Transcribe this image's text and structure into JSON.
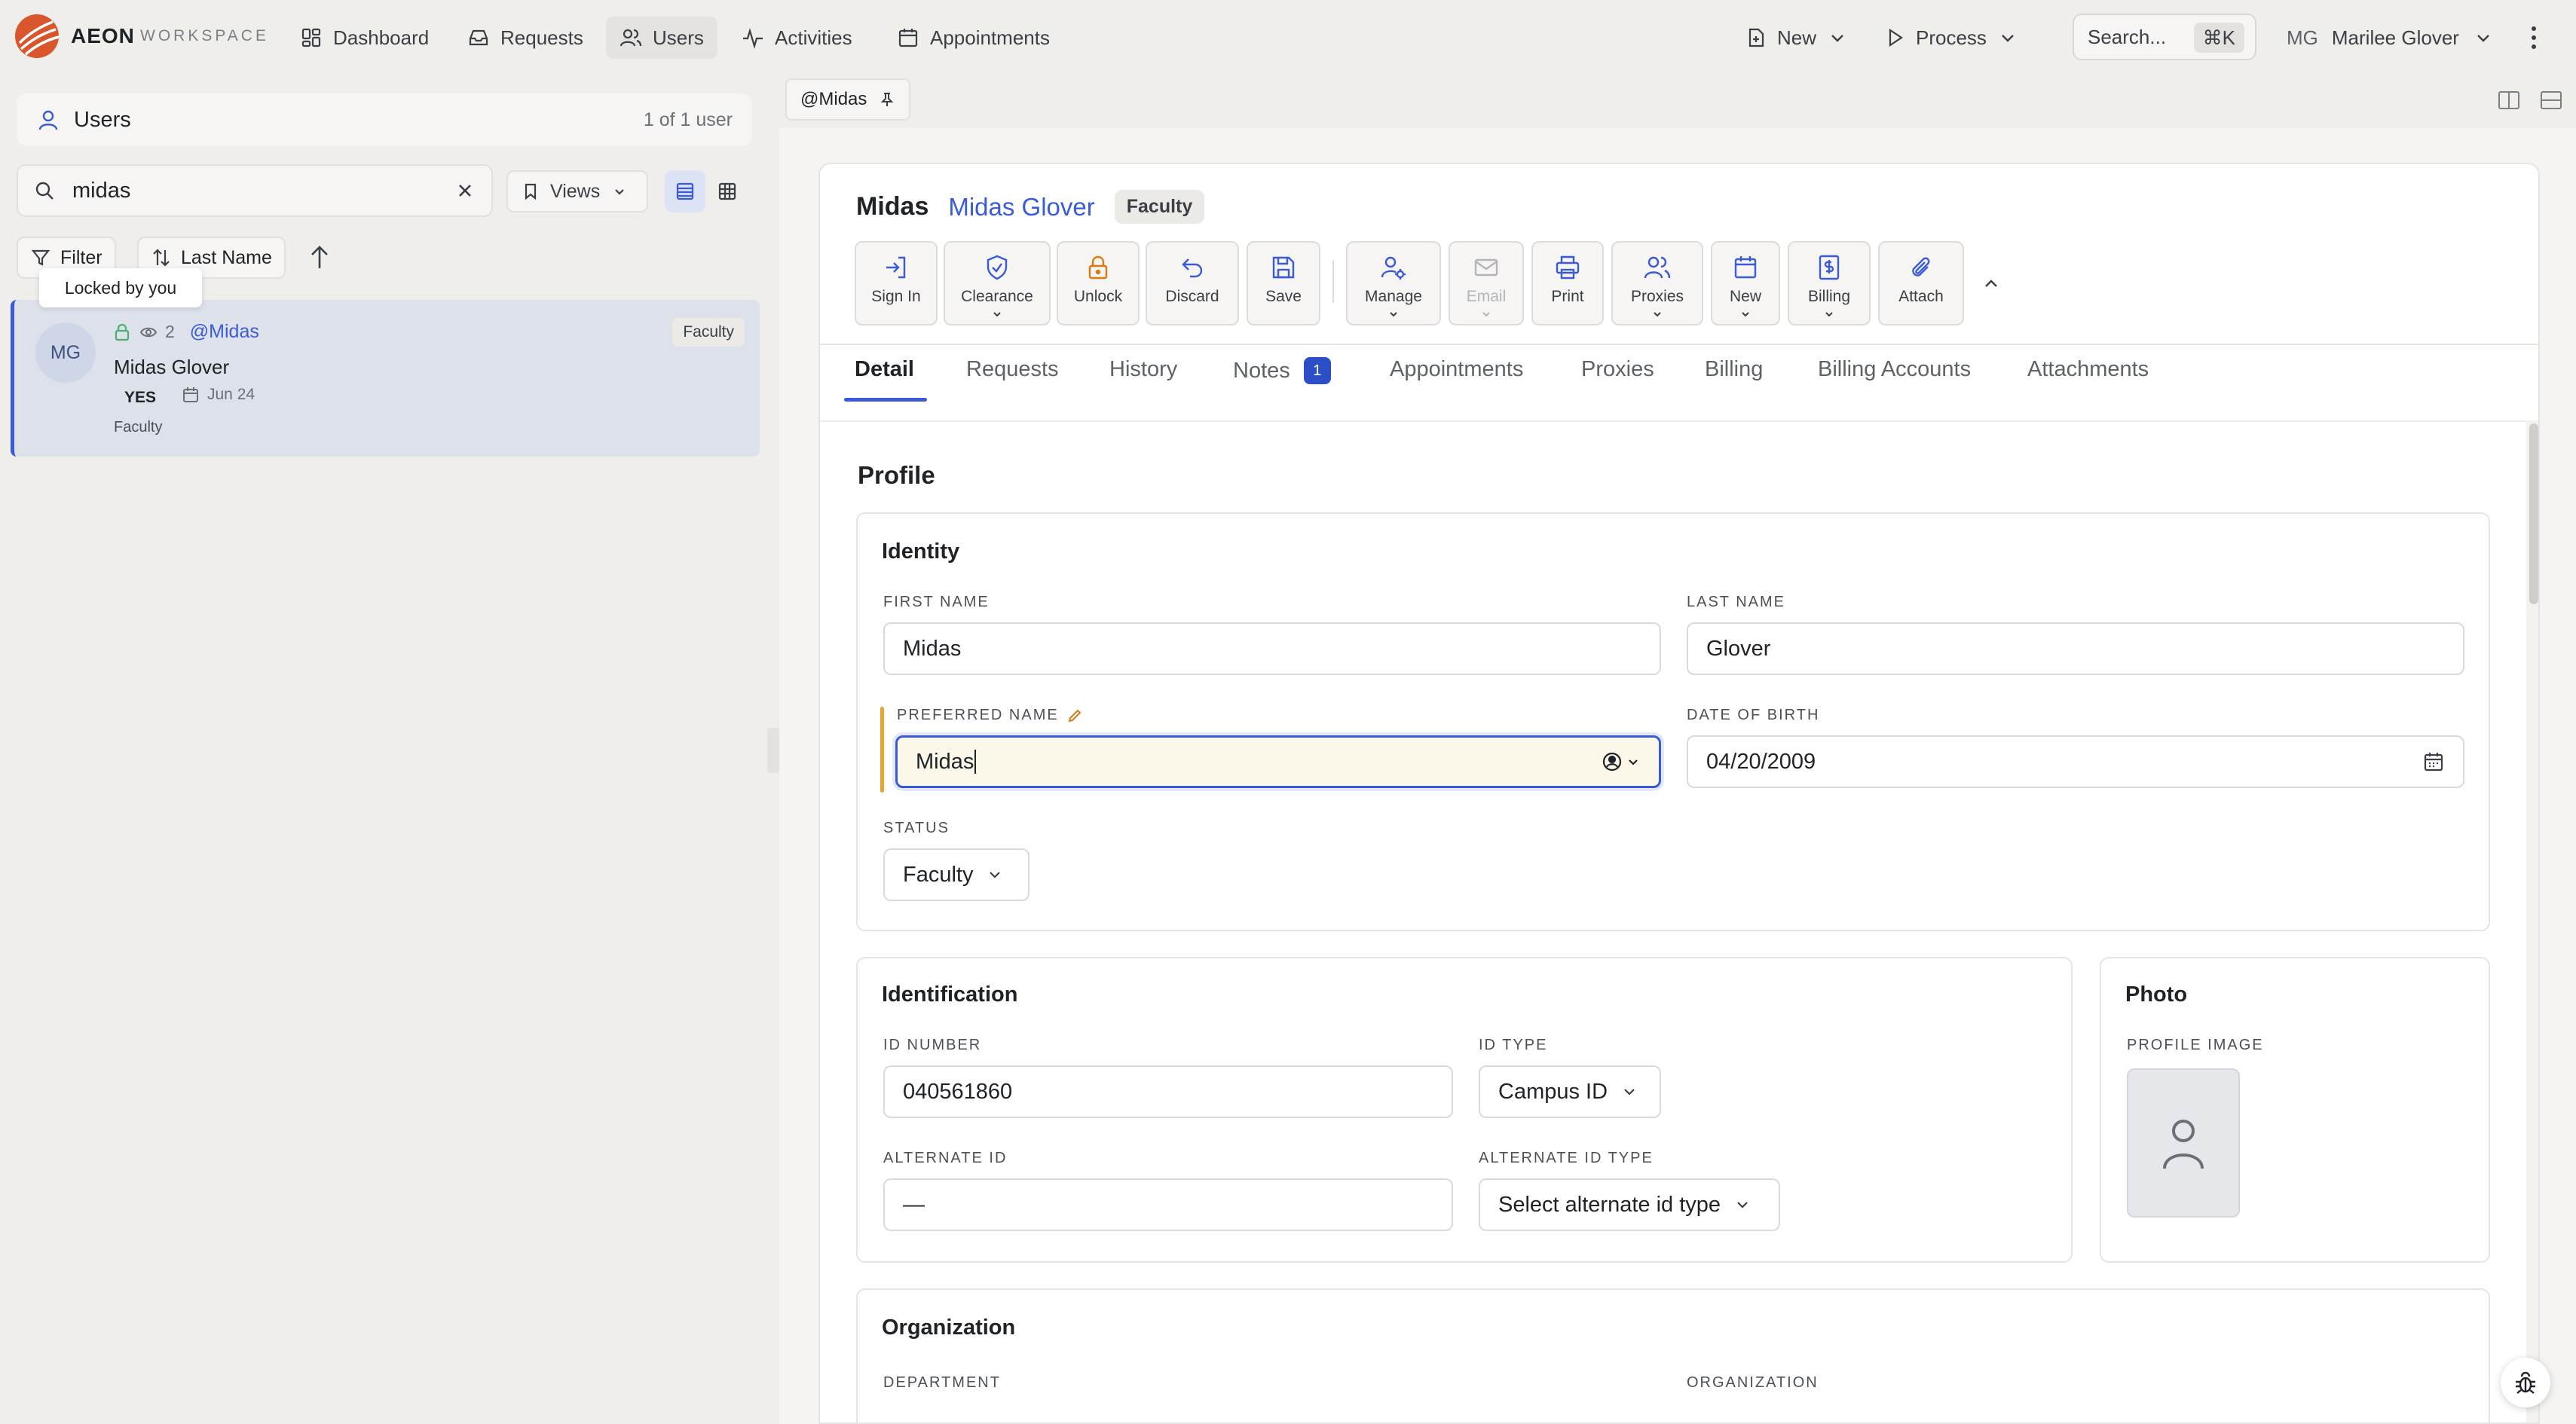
{
  "brand": {
    "name": "AEON",
    "sub": "WORKSPACE",
    "accent": "#d9552b"
  },
  "nav": [
    {
      "label": "Dashboard",
      "icon": "dashboard-icon"
    },
    {
      "label": "Requests",
      "icon": "inbox-icon"
    },
    {
      "label": "Users",
      "icon": "users-icon",
      "active": true
    },
    {
      "label": "Activities",
      "icon": "activity-icon"
    },
    {
      "label": "Appointments",
      "icon": "calendar-icon"
    }
  ],
  "topbar": {
    "new_label": "New",
    "process_label": "Process",
    "search_label": "Search...",
    "search_shortcut": "⌘K",
    "user_initials": "MG",
    "user_name": "Marilee Glover"
  },
  "left": {
    "title": "Users",
    "count": "1 of 1 user",
    "search_value": "midas",
    "views_label": "Views",
    "filter_label": "Filter",
    "sort_label": "Last Name",
    "tooltip": "Locked by you"
  },
  "user_card": {
    "initials": "MG",
    "views": "2",
    "handle": "@Midas",
    "name": "Midas Glover",
    "flag": "YES",
    "date": "Jun 24",
    "status": "Faculty",
    "badge": "Faculty"
  },
  "doc_tab": {
    "label": "@Midas"
  },
  "record": {
    "short_name": "Midas",
    "full_name": "Midas Glover",
    "badge": "Faculty"
  },
  "actions": [
    {
      "label": "Sign In",
      "icon": "sign-in-icon"
    },
    {
      "label": "Clearance",
      "icon": "shield-check-icon",
      "dropdown": true
    },
    {
      "label": "Unlock",
      "icon": "lock-icon"
    },
    {
      "label": "Discard",
      "icon": "undo-icon"
    },
    {
      "label": "Save",
      "icon": "save-icon"
    },
    {
      "label": "Manage",
      "icon": "user-gear-icon",
      "dropdown": true
    },
    {
      "label": "Email",
      "icon": "mail-icon",
      "dropdown": true,
      "disabled": true
    },
    {
      "label": "Print",
      "icon": "printer-icon"
    },
    {
      "label": "Proxies",
      "icon": "users-icon",
      "dropdown": true
    },
    {
      "label": "New",
      "icon": "calendar-icon",
      "dropdown": true
    },
    {
      "label": "Billing",
      "icon": "invoice-icon",
      "dropdown": true
    },
    {
      "label": "Attach",
      "icon": "paperclip-icon"
    }
  ],
  "tabs": [
    {
      "label": "Detail",
      "active": true
    },
    {
      "label": "Requests"
    },
    {
      "label": "History"
    },
    {
      "label": "Notes",
      "count": "1"
    },
    {
      "label": "Appointments"
    },
    {
      "label": "Proxies"
    },
    {
      "label": "Billing"
    },
    {
      "label": "Billing Accounts"
    },
    {
      "label": "Attachments"
    }
  ],
  "profile": {
    "section_title": "Profile",
    "identity": {
      "title": "Identity",
      "first_name_label": "FIRST NAME",
      "first_name": "Midas",
      "last_name_label": "LAST NAME",
      "last_name": "Glover",
      "preferred_label": "PREFERRED NAME",
      "preferred": "Midas",
      "dob_label": "DATE OF BIRTH",
      "dob": "04/20/2009",
      "status_label": "STATUS",
      "status": "Faculty"
    },
    "identification": {
      "title": "Identification",
      "id_number_label": "ID NUMBER",
      "id_number": "040561860",
      "id_type_label": "ID TYPE",
      "id_type": "Campus ID",
      "alt_id_label": "ALTERNATE ID",
      "alt_id": "—",
      "alt_id_type_label": "ALTERNATE ID TYPE",
      "alt_id_type": "Select alternate id type"
    },
    "photo": {
      "title": "Photo",
      "label": "PROFILE IMAGE"
    },
    "organization": {
      "title": "Organization",
      "department_label": "DEPARTMENT",
      "organization_label": "ORGANIZATION"
    }
  },
  "colors": {
    "accent": "#3b5bd6",
    "edited_bar": "#e6a431",
    "lock_orange": "#d97a12",
    "lock_green": "#4caf74"
  }
}
